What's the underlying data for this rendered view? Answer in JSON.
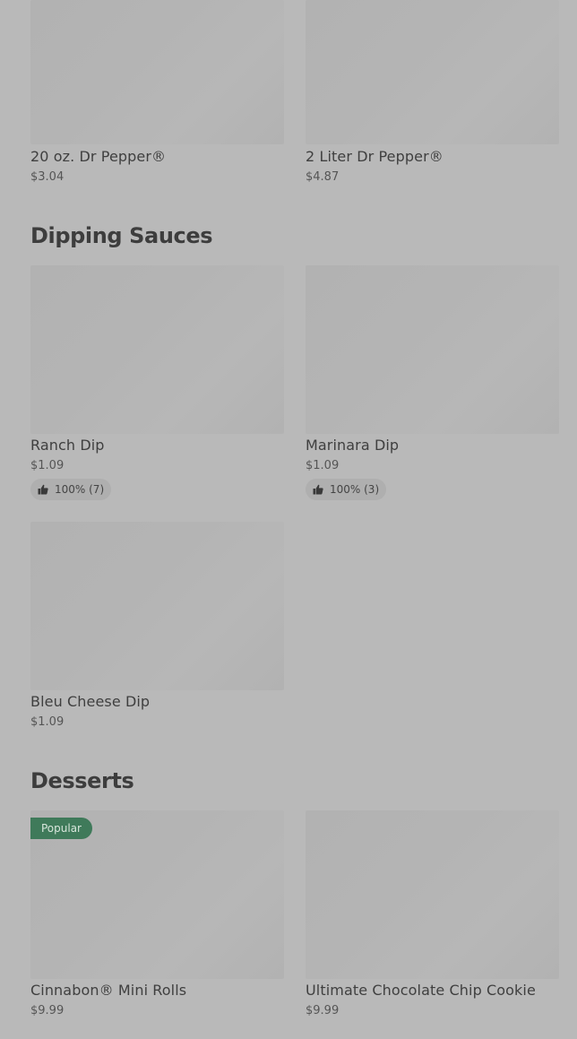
{
  "drinks": {
    "items": [
      {
        "name": "20 oz. Dr Pepper®",
        "price": "$3.04"
      },
      {
        "name": "2 Liter Dr Pepper®",
        "price": "$4.87"
      }
    ]
  },
  "dipping_sauces": {
    "title": "Dipping Sauces",
    "items": [
      {
        "name": "Ranch Dip",
        "price": "$1.09",
        "rating": "100% (7)"
      },
      {
        "name": "Marinara Dip",
        "price": "$1.09",
        "rating": "100% (3)"
      },
      {
        "name": "Bleu Cheese Dip",
        "price": "$1.09"
      }
    ]
  },
  "desserts": {
    "title": "Desserts",
    "items": [
      {
        "name": "Cinnabon® Mini Rolls",
        "price": "$9.99",
        "badge": "Popular"
      },
      {
        "name": "Ultimate Chocolate Chip Cookie",
        "price": "$9.99"
      }
    ]
  },
  "icons": {
    "rating": "thumbs-up-icon"
  },
  "colors": {
    "background": "#b9b9b9",
    "popular_badge": "#3f7a5a"
  }
}
